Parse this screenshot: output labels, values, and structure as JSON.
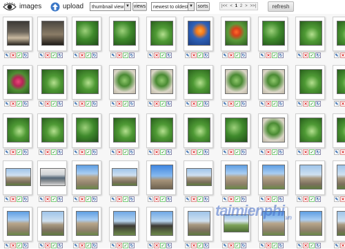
{
  "toolbar": {
    "images_label": "images",
    "upload_label": "upload",
    "view_select": "thumbnail view",
    "views_button": "views",
    "sort_select": "newest to oldest",
    "sorts_button": "sorts",
    "pager": {
      "first": "|<<",
      "prev": "<",
      "current": "1",
      "next": "2",
      "next_arrow": ">",
      "last": ">>|"
    },
    "refresh_label": "refresh"
  },
  "watermark": {
    "text": "taimienphi",
    "suffix": ".vn"
  },
  "actions": {
    "edit": "✎",
    "delete": "✕",
    "approve": "✓",
    "rotate": "↻"
  },
  "rows": [
    {
      "cells": [
        {
          "style": "dusk",
          "icon": "photo"
        },
        {
          "style": "dusk2",
          "icon": "photo"
        },
        {
          "style": "forest",
          "icon": "photo"
        },
        {
          "style": "forest",
          "icon": "photo"
        },
        {
          "style": "leaves",
          "icon": "photo"
        },
        {
          "style": "blueflower",
          "icon": "photo"
        },
        {
          "style": "redflower",
          "icon": "photo"
        },
        {
          "style": "forest",
          "icon": "photo"
        },
        {
          "style": "leaves",
          "icon": "photo"
        },
        {
          "style": "leaves",
          "icon": "photo"
        }
      ]
    },
    {
      "cells": [
        {
          "style": "pinkflower",
          "icon": "photo"
        },
        {
          "style": "leaves",
          "icon": "photo"
        },
        {
          "style": "leaves",
          "icon": "photo"
        },
        {
          "style": "plant",
          "icon": "photo"
        },
        {
          "style": "plant",
          "icon": "photo"
        },
        {
          "style": "leaves",
          "icon": "photo"
        },
        {
          "style": "plant",
          "icon": "photo"
        },
        {
          "style": "plant",
          "icon": "photo"
        },
        {
          "style": "leaves",
          "icon": "photo"
        },
        {
          "style": "leaves",
          "icon": "photo"
        }
      ]
    },
    {
      "cells": [
        {
          "style": "leaves",
          "icon": "photo"
        },
        {
          "style": "leaves",
          "icon": "photo"
        },
        {
          "style": "forest",
          "icon": "photo"
        },
        {
          "style": "leaves",
          "icon": "photo"
        },
        {
          "style": "leaves",
          "icon": "photo"
        },
        {
          "style": "leaves",
          "icon": "photo"
        },
        {
          "style": "forest",
          "icon": "photo"
        },
        {
          "style": "plant",
          "icon": "photo"
        },
        {
          "style": "leaves",
          "icon": "photo"
        },
        {
          "style": "leaves",
          "icon": "photo"
        }
      ]
    },
    {
      "cells": [
        {
          "style": "ruin",
          "icon": "photo",
          "wide": true
        },
        {
          "style": "car",
          "icon": "photo",
          "wide": true
        },
        {
          "style": "mission",
          "icon": "photo"
        },
        {
          "style": "ruin",
          "icon": "photo",
          "wide": true
        },
        {
          "style": "cross",
          "icon": "photo"
        },
        {
          "style": "ruin",
          "icon": "photo",
          "wide": true
        },
        {
          "style": "mission",
          "icon": "photo"
        },
        {
          "style": "mission",
          "icon": "photo"
        },
        {
          "style": "ruin",
          "icon": "photo"
        },
        {
          "style": "ruin",
          "icon": "photo"
        }
      ]
    },
    {
      "cells": [
        {
          "style": "mission",
          "icon": "photo"
        },
        {
          "style": "ruin",
          "icon": "photo"
        },
        {
          "style": "mission",
          "icon": "photo"
        },
        {
          "style": "trees",
          "icon": "photo"
        },
        {
          "style": "trees",
          "icon": "photo"
        },
        {
          "style": "ruin",
          "icon": "photo"
        },
        {
          "style": "field",
          "icon": "photo",
          "wide": true
        },
        {
          "style": "mission",
          "icon": "photo"
        },
        {
          "style": "mission",
          "icon": "photo"
        },
        {
          "style": "ruin",
          "icon": "photo"
        }
      ]
    }
  ]
}
